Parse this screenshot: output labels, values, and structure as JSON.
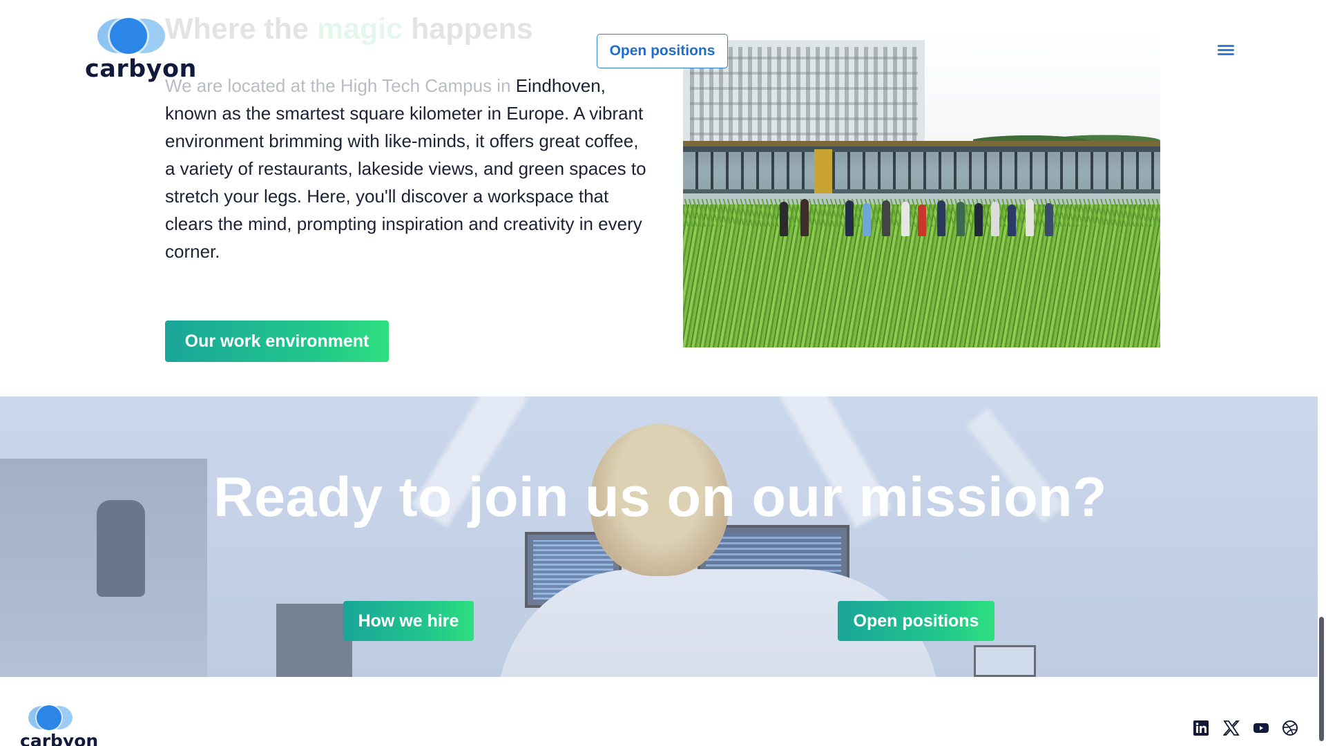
{
  "header": {
    "logo_text": "carbyon",
    "open_positions_label": "Open positions",
    "menu_icon": "hamburger-menu-icon"
  },
  "intro": {
    "title_before": "Where the ",
    "title_accent": "magic",
    "title_after": " happens",
    "text_faded": "We are located at the High Tech Campus in",
    "text": "Eindhoven, known as the smartest square kilometer in Europe. A vibrant environment brimming with like-minds, it offers great coffee, a variety of restaurants, lakeside views, and green spaces to stretch your legs. Here, you'll discover a workspace that clears the mind, prompting inspiration and creativity in every corner.",
    "button_label": "Our work environment"
  },
  "cta": {
    "title": "Ready to join us on our mission?",
    "how_we_hire_label": "How we hire",
    "open_positions_label": "Open positions"
  },
  "footer": {
    "logo_text": "carbyon",
    "social_icons": [
      "linkedin-icon",
      "x-icon",
      "youtube-icon",
      "dribbble-icon"
    ]
  },
  "colors": {
    "brand_blue": "#2f7fd8",
    "accent_green": "#21c46b",
    "button_gradient_start": "#1aa59a",
    "button_gradient_end": "#2fe07f",
    "text_dark": "#1c2135"
  }
}
